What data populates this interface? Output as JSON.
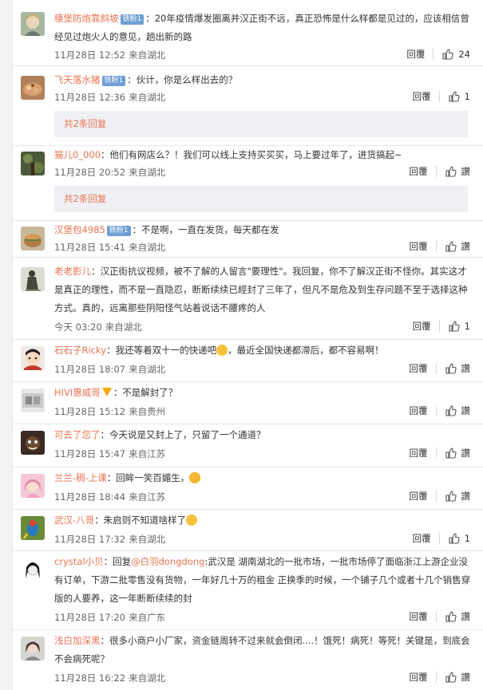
{
  "colors": {
    "accent": "#eb7350",
    "badge": "#6e9fd6",
    "meta": "#666666"
  },
  "actions": {
    "reply": "回覆"
  },
  "comments": [
    {
      "user": "棲堡防炮靠斜坡",
      "badge": "铁粉1",
      "has_badge": true,
      "text": "：20年疫情爆发圈离并汉正街不远，真正恐怖是什么样都是见过的，应该相信曾经见过炮火人的意见，趟出新的路",
      "time": "11月28日 12:52",
      "source": "来自湖北",
      "likes": "24"
    },
    {
      "user": "飞天落水猪",
      "badge": "铁粉1",
      "has_badge": true,
      "text": "：伙计，你是么样出去的？",
      "time": "11月28日 12:36",
      "source": "来自湖北",
      "likes": "1",
      "more": "共2条回复"
    },
    {
      "user": "猫儿0_000",
      "text": "：他们有网店么？！我们可以线上支持买买买，马上要过年了，进货搞起~",
      "time": "11月28日 20:52",
      "source": "来自湖北",
      "likes": "讚",
      "more": "共2条回复"
    },
    {
      "user": "汉堡包4985",
      "badge": "铁粉1",
      "has_badge": true,
      "text": "：不是啊，一直在发货，每天都在发",
      "time": "11月28日 15:41",
      "source": "来自湖北",
      "likes": "讚"
    },
    {
      "user": "老老影儿",
      "text": "：汉正街抗议视频，被不了解的人留言\"要理性\"。我回复，你不了解汉正街不怪你。其实这才是真正的理性，而不是一直隐忍，断断续续已經封了三年了，但凡不是危及到生存问题不至于选择这种方式。真的，远离那些阴阳怪气站着说话不腰疼的人",
      "time": "今天 03:20",
      "source": "来自湖北",
      "likes": "1"
    },
    {
      "user": "石石子Ricky",
      "text": "：我还等着双十一的快递吧",
      "text_after": "，最近全国快递都滞后，都不容易啊！",
      "emoji": "smile",
      "time": "11月28日 18:07",
      "source": "来自湖北",
      "likes": "讚"
    },
    {
      "user": "HIVI惠威哥",
      "vip": true,
      "text": "：不是解封了？",
      "time": "11月28日 15:12",
      "source": "来自贵州",
      "likes": "讚"
    },
    {
      "user": "可去了您了",
      "text": "：今天说是又封上了，只留了一个通道？",
      "time": "11月28日 15:47",
      "source": "来自江苏",
      "likes": "讚"
    },
    {
      "user": "兰兰-稠-上课",
      "text": "：回眸一笑百媚生，",
      "emoji": "heart-eyes",
      "time": "11月28日 18:44",
      "source": "来自江苏",
      "likes": "讚"
    },
    {
      "user": "武汉-八哥",
      "text": "：朱启则不知道啥样了",
      "emoji": "laugh-cry",
      "time": "11月28日 17:32",
      "source": "来自湖北",
      "likes": "1"
    },
    {
      "user": "crystal小贝",
      "text_pre": "：回复",
      "mention": "@白羽dongdong",
      "text": ":武汉是 湖南湖北的一批市场，一批市场停了面临浙江上游企业没有订单，下游二批零售没有货物，一年好几十万的租金 正换季的时候，一个铺子几个或者十几个销售穿版的人要养，这一年断断续续的封",
      "time": "11月28日 17:20",
      "source": "来自广东",
      "likes": "讚"
    },
    {
      "user": "浅白加深黑",
      "text": "：很多小商户小厂家，资金链周转不过来就会倒闭....！饿死！病死！等死！关键是，到底会不会病死呢？",
      "time": "11月28日 16:22",
      "source": "来自湖北",
      "likes": "讚"
    }
  ]
}
